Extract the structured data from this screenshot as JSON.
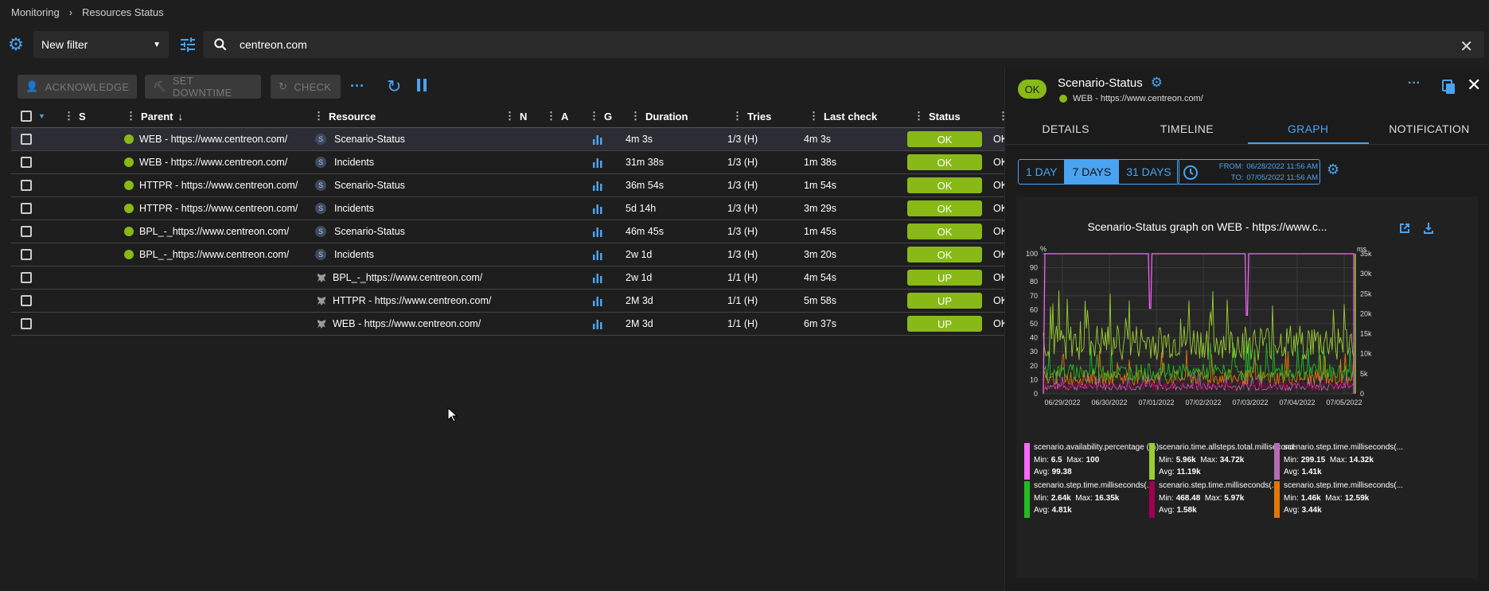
{
  "breadcrumb": [
    "Monitoring",
    "Resources Status"
  ],
  "filter": {
    "selected": "New filter",
    "search_value": "centreon.com"
  },
  "actions": {
    "acknowledge": "ACKNOWLEDGE",
    "downtime": "SET DOWNTIME",
    "check": "CHECK"
  },
  "columns": [
    "S",
    "Parent",
    "Resource",
    "N",
    "A",
    "G",
    "Duration",
    "Tries",
    "Last check",
    "Status"
  ],
  "rows": [
    {
      "parent": "WEB - https://www.centreon.com/",
      "badge": "S",
      "resource": "Scenario-Status",
      "duration": "4m 3s",
      "tries": "1/3 (H)",
      "last_check": "4m 3s",
      "status": "OK",
      "info": "OK"
    },
    {
      "parent": "WEB - https://www.centreon.com/",
      "badge": "S",
      "resource": "Incidents",
      "duration": "31m 38s",
      "tries": "1/3 (H)",
      "last_check": "1m 38s",
      "status": "OK",
      "info": "OK"
    },
    {
      "parent": "HTTPR - https://www.centreon.com/",
      "badge": "S",
      "resource": "Scenario-Status",
      "duration": "36m 54s",
      "tries": "1/3 (H)",
      "last_check": "1m 54s",
      "status": "OK",
      "info": "OK"
    },
    {
      "parent": "HTTPR - https://www.centreon.com/",
      "badge": "S",
      "resource": "Incidents",
      "duration": "5d 14h",
      "tries": "1/3 (H)",
      "last_check": "3m 29s",
      "status": "OK",
      "info": "OK"
    },
    {
      "parent": "BPL_-_https://www.centreon.com/",
      "badge": "S",
      "resource": "Scenario-Status",
      "duration": "46m 45s",
      "tries": "1/3 (H)",
      "last_check": "1m 45s",
      "status": "OK",
      "info": "OK"
    },
    {
      "parent": "BPL_-_https://www.centreon.com/",
      "badge": "S",
      "resource": "Incidents",
      "duration": "2w 1d",
      "tries": "1/3 (H)",
      "last_check": "3m 20s",
      "status": "OK",
      "info": "OK"
    },
    {
      "parent": "",
      "badge": "",
      "resource": "BPL_-_https://www.centreon.com/",
      "duration": "2w 1d",
      "tries": "1/1 (H)",
      "last_check": "4m 54s",
      "status": "UP",
      "info": "OK"
    },
    {
      "parent": "",
      "badge": "",
      "resource": "HTTPR - https://www.centreon.com/",
      "duration": "2M 3d",
      "tries": "1/1 (H)",
      "last_check": "5m 58s",
      "status": "UP",
      "info": "OK"
    },
    {
      "parent": "",
      "badge": "",
      "resource": "WEB - https://www.centreon.com/",
      "duration": "2M 3d",
      "tries": "1/1 (H)",
      "last_check": "6m 37s",
      "status": "UP",
      "info": "OK"
    }
  ],
  "panel": {
    "status": "OK",
    "title": "Scenario-Status",
    "subtitle": "WEB - https://www.centreon.com/",
    "tabs": [
      "DETAILS",
      "TIMELINE",
      "GRAPH",
      "NOTIFICATION"
    ],
    "ranges": [
      "1 DAY",
      "7 DAYS",
      "31 DAYS"
    ],
    "from_label": "FROM:",
    "from_value": "06/28/2022 11:56 AM",
    "to_label": "TO:",
    "to_value": "07/05/2022 11:56 AM",
    "graph_title": "Scenario-Status graph on WEB - https://www.c..."
  },
  "chart_data": {
    "type": "line",
    "title": "Scenario-Status graph on WEB - https://www.c...",
    "ylabel_left": "%",
    "ylabel_right": "ms",
    "left_ticks": [
      "0",
      "10",
      "20",
      "30",
      "40",
      "50",
      "60",
      "70",
      "80",
      "90",
      "100"
    ],
    "right_ticks": [
      "0",
      "5k",
      "10k",
      "15k",
      "20k",
      "25k",
      "30k",
      "35k"
    ],
    "x_ticks": [
      "06/29/2022",
      "06/30/2022",
      "07/01/2022",
      "07/02/2022",
      "07/03/2022",
      "07/04/2022",
      "07/05/2022"
    ],
    "ylim_left": [
      0,
      100
    ],
    "ylim_right": [
      0,
      35000
    ],
    "grid": true,
    "series": [
      {
        "name": "scenario.availability.percentage (%)",
        "color": "#ff66ff",
        "min": "6.5",
        "max": "100",
        "avg": "99.38"
      },
      {
        "name": "scenario.time.allsteps.total.milliseconds",
        "color": "#9acd32",
        "min": "5.96k",
        "max": "34.72k",
        "avg": "11.19k"
      },
      {
        "name": "scenario.step.time.milliseconds(...",
        "color": "#b36cb3",
        "min": "299.15",
        "max": "14.32k",
        "avg": "1.41k"
      },
      {
        "name": "scenario.step.time.milliseconds(...",
        "color": "#22bb22",
        "min": "2.64k",
        "max": "16.35k",
        "avg": "4.81k"
      },
      {
        "name": "scenario.step.time.milliseconds(...",
        "color": "#a0004f",
        "min": "468.48",
        "max": "5.97k",
        "avg": "1.58k"
      },
      {
        "name": "scenario.step.time.milliseconds(...",
        "color": "#e0770a",
        "min": "1.46k",
        "max": "12.59k",
        "avg": "3.44k"
      }
    ]
  },
  "legend_labels": {
    "min": "Min:",
    "max": "Max:",
    "avg": "Avg:"
  }
}
